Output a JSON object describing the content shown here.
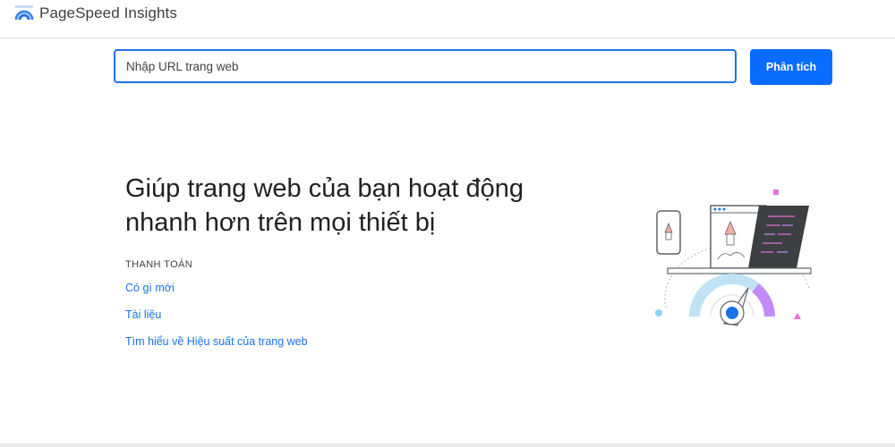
{
  "header": {
    "app_name": "PageSpeed Insights",
    "logo_icon": "pagespeed-gauge-icon"
  },
  "search": {
    "placeholder": "Nhập URL trang web",
    "button_label": "Phân tích"
  },
  "hero": {
    "title": "Giúp trang web của bạn hoạt động nhanh hơn trên mọi thiết bị"
  },
  "links": {
    "section_label": "THANH TOÁN",
    "items": [
      {
        "label": "Có gì mới"
      },
      {
        "label": "Tài liệu"
      },
      {
        "label": "Tìm hiểu về Hiệu suất của trang web"
      }
    ]
  },
  "illustration": {
    "icon": "speed-gauge-rocket-illustration",
    "colors": {
      "gauge_blue": "#1a73e8",
      "gauge_purple": "#c58af9",
      "gauge_light_blue": "#bfe3f5",
      "accent_pink": "#e86fd9",
      "code_panel": "#3c4043"
    }
  },
  "theme": {
    "primary": "#1a73e8",
    "button_bg": "#0a6cff",
    "text": "#202124"
  }
}
